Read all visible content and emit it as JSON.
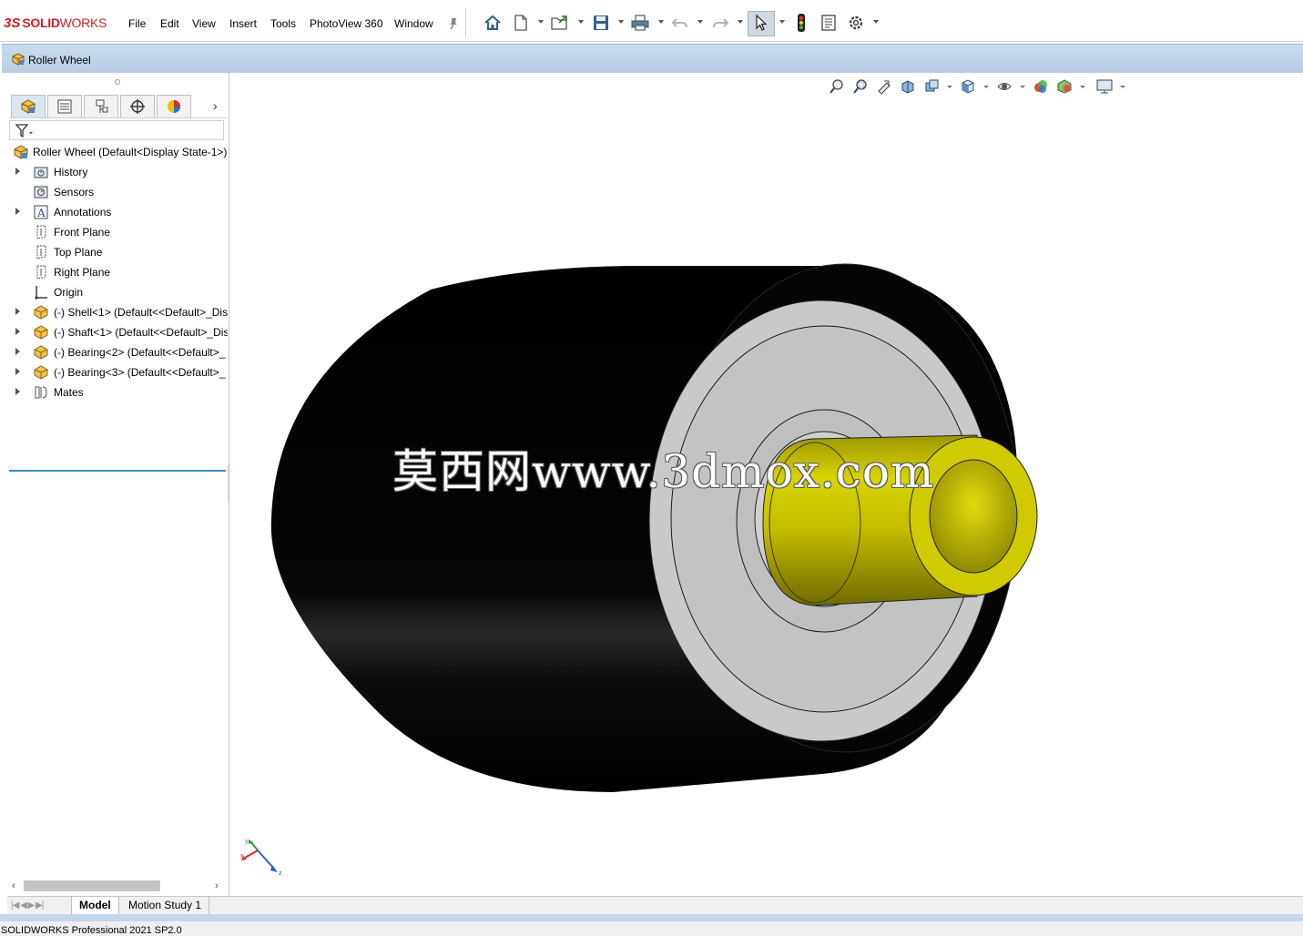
{
  "app": {
    "brand_prefix": "3S",
    "brand_bold": "SOLID",
    "brand_light": "WORKS"
  },
  "menu": {
    "items": [
      "File",
      "Edit",
      "View",
      "Insert",
      "Tools",
      "PhotoView 360",
      "Window"
    ]
  },
  "toolbar": {
    "icons": [
      "home-icon",
      "new-document-icon",
      "open-folder-icon",
      "save-icon",
      "print-icon",
      "undo-icon",
      "redo-icon",
      "select-arrow-icon",
      "rebuild-traffic-light-icon",
      "file-properties-icon",
      "options-gear-icon"
    ]
  },
  "document": {
    "title": "Roller Wheel"
  },
  "feature_manager": {
    "tabs": [
      "featuremanager-tab",
      "propertymanager-tab",
      "configurationmanager-tab",
      "dimxpert-tab",
      "display-manager-tab"
    ],
    "root_label": "Roller Wheel  (Default<Display State-1>)",
    "items": [
      {
        "label": "History",
        "expandable": true,
        "icon": "history-folder-icon"
      },
      {
        "label": "Sensors",
        "expandable": false,
        "icon": "sensors-icon"
      },
      {
        "label": "Annotations",
        "expandable": true,
        "icon": "annotations-icon"
      },
      {
        "label": "Front Plane",
        "expandable": false,
        "icon": "plane-icon"
      },
      {
        "label": "Top Plane",
        "expandable": false,
        "icon": "plane-icon"
      },
      {
        "label": "Right Plane",
        "expandable": false,
        "icon": "plane-icon"
      },
      {
        "label": "Origin",
        "expandable": false,
        "icon": "origin-icon"
      },
      {
        "label": "(-) Shell<1> (Default<<Default>_Dis",
        "expandable": true,
        "icon": "part-icon"
      },
      {
        "label": "(-) Shaft<1> (Default<<Default>_Dis",
        "expandable": true,
        "icon": "part-icon"
      },
      {
        "label": "(-) Bearing<2> (Default<<Default>_",
        "expandable": true,
        "icon": "part-icon"
      },
      {
        "label": "(-) Bearing<3> (Default<<Default>_",
        "expandable": true,
        "icon": "part-icon"
      },
      {
        "label": "Mates",
        "expandable": true,
        "icon": "mates-icon"
      }
    ]
  },
  "viewport": {
    "watermark": "莫西网www.3dmox.com",
    "hud_icons": [
      "zoom-to-fit-icon",
      "zoom-to-area-icon",
      "previous-view-icon",
      "section-view-icon",
      "dynamic-annotation-views-icon",
      "view-orientation-icon",
      "display-style-icon",
      "hide-show-items-icon",
      "edit-appearance-icon",
      "apply-scene-icon",
      "view-settings-icon"
    ],
    "colors": {
      "tire": "#050505",
      "hub": "#c8c8c8",
      "shaft": "#c9c400"
    }
  },
  "bottom_tabs": {
    "nav": "|◀ ◀ ▶ ▶|",
    "items": [
      "Model",
      "Motion Study 1"
    ],
    "active": "Model"
  },
  "status": {
    "text": "SOLIDWORKS Professional 2021 SP2.0"
  }
}
